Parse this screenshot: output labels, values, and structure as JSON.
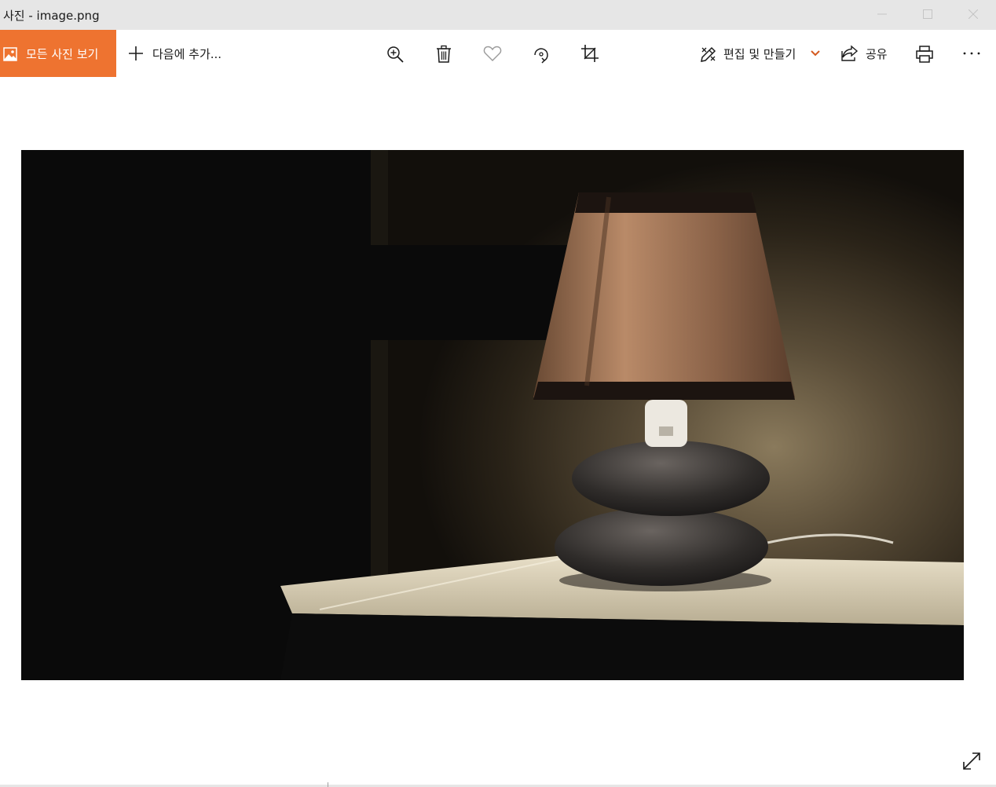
{
  "window": {
    "title": "사진 - image.png",
    "controls": {
      "minimize": "minimize-icon",
      "maximize": "maximize-icon",
      "close": "close-icon"
    }
  },
  "toolbar": {
    "all_photos_label": "모든 사진 보기",
    "add_to_label": "다음에 추가...",
    "zoom_icon": "zoom-in-icon",
    "delete_icon": "trash-icon",
    "favorite_icon": "heart-icon",
    "rotate_icon": "rotate-icon",
    "crop_icon": "crop-icon",
    "edit_create_label": "편집 및 만들기",
    "share_label": "공유",
    "print_icon": "print-icon",
    "more_icon": "more-icon"
  },
  "colors": {
    "accent": "#ee7330",
    "titlebar": "#e6e6e6",
    "chevron": "#d45a20"
  },
  "viewer": {
    "fullscreen_icon": "fullscreen-icon"
  }
}
